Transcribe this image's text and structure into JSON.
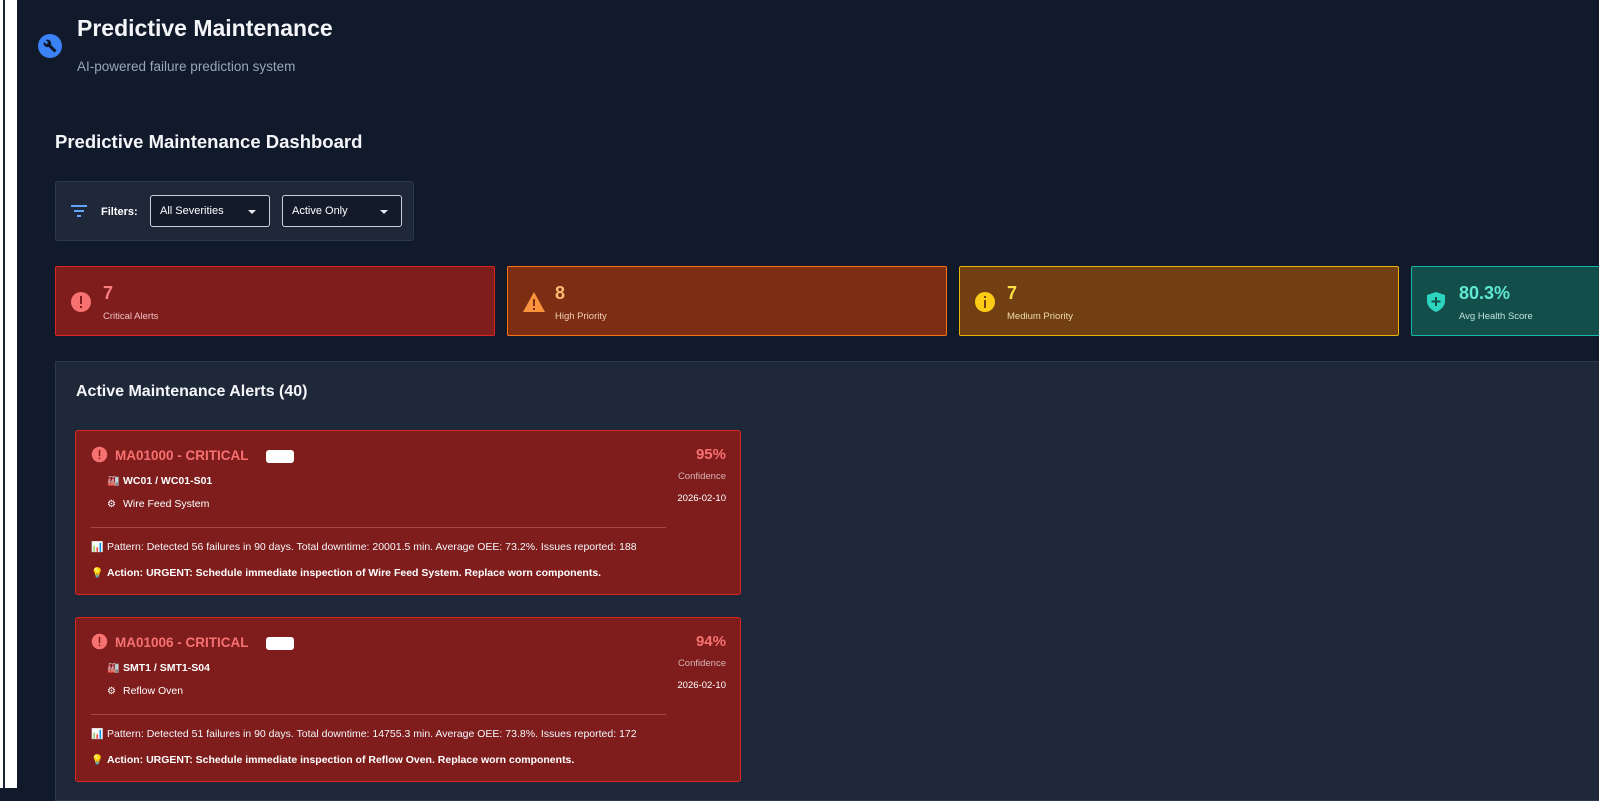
{
  "header": {
    "title": "Predictive Maintenance",
    "subtitle": "AI-powered failure prediction system"
  },
  "dashboard": {
    "title": "Predictive Maintenance Dashboard"
  },
  "filters": {
    "label": "Filters:",
    "severity_selected": "All Severities",
    "status_selected": "Active Only"
  },
  "stats": {
    "critical": {
      "value": "7",
      "label": "Critical Alerts",
      "color": "#7f1d1d"
    },
    "high": {
      "value": "8",
      "label": "High Priority",
      "color": "#7c2d12"
    },
    "medium": {
      "value": "7",
      "label": "Medium Priority",
      "color": "#713f12"
    },
    "health": {
      "value": "80.3%",
      "label": "Avg Health Score",
      "color": "#134e4a"
    }
  },
  "alerts_panel": {
    "title": "Active Maintenance Alerts (40)",
    "alerts": [
      {
        "id": "MA01000 - CRITICAL",
        "location": "WC01 / WC01-S01",
        "component": "Wire Feed System",
        "pattern": "Pattern: Detected 56 failures in 90 days. Total downtime: 20001.5 min. Average OEE: 73.2%. Issues reported: 188",
        "action": "Action: URGENT: Schedule immediate inspection of Wire Feed System. Replace worn components.",
        "confidence": "95%",
        "confidence_label": "Confidence",
        "date": "2026-02-10"
      },
      {
        "id": "MA01006 - CRITICAL",
        "location": "SMT1 / SMT1-S04",
        "component": "Reflow Oven",
        "pattern": "Pattern: Detected 51 failures in 90 days. Total downtime: 14755.3 min. Average OEE: 73.8%. Issues reported: 172",
        "action": "Action: URGENT: Schedule immediate inspection of Reflow Oven. Replace worn components.",
        "confidence": "94%",
        "confidence_label": "Confidence",
        "date": "2026-02-10"
      }
    ]
  },
  "icons": {
    "app": "wrench-icon",
    "filter": "filter-icon",
    "critical": "alert-circle-icon",
    "high": "warning-triangle-icon",
    "medium": "info-circle-icon",
    "health": "shield-plus-icon",
    "location": "factory-icon",
    "component": "gear-icon",
    "pattern": "chart-icon",
    "action": "lightbulb-icon"
  }
}
